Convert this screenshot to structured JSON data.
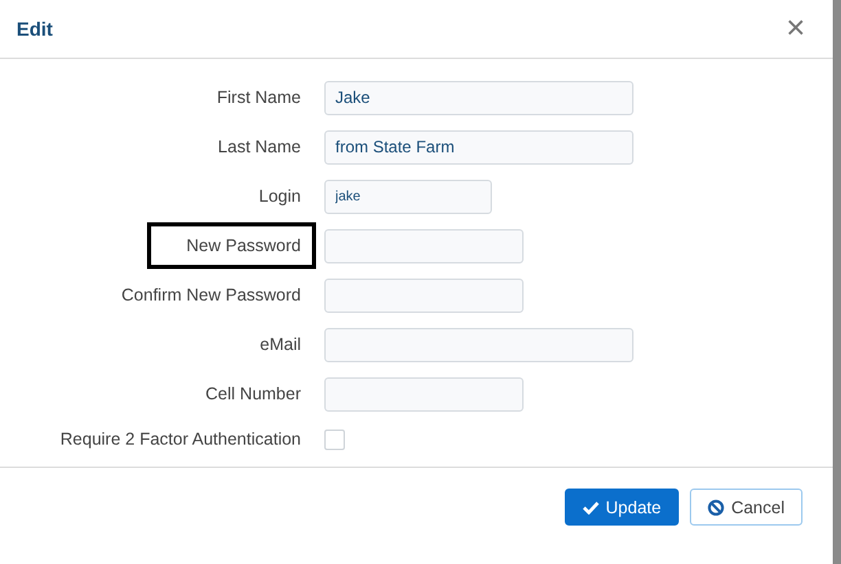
{
  "dialog": {
    "title": "Edit",
    "close": "×"
  },
  "fields": [
    {
      "label": "First Name",
      "kind": "text",
      "value": "Jake",
      "highlighted": false
    },
    {
      "label": "Last Name",
      "kind": "text",
      "value": "from State Farm",
      "highlighted": false
    },
    {
      "label": "Login",
      "kind": "text",
      "value": "jake",
      "highlighted": false
    },
    {
      "label": "New Password",
      "kind": "text",
      "highlighted": true
    },
    {
      "label": "Confirm New Password",
      "kind": "text",
      "highlighted": false
    },
    {
      "label": "eMail",
      "kind": "text",
      "highlighted": false
    },
    {
      "label": "Cell Number",
      "kind": "text",
      "highlighted": false
    },
    {
      "label": "Require 2 Factor Authentication",
      "kind": "checkbox",
      "checked": false,
      "highlighted": false
    }
  ],
  "buttons": [
    {
      "label": "Update",
      "kind": "primary"
    },
    {
      "label": "Cancel",
      "kind": "secondary"
    }
  ]
}
